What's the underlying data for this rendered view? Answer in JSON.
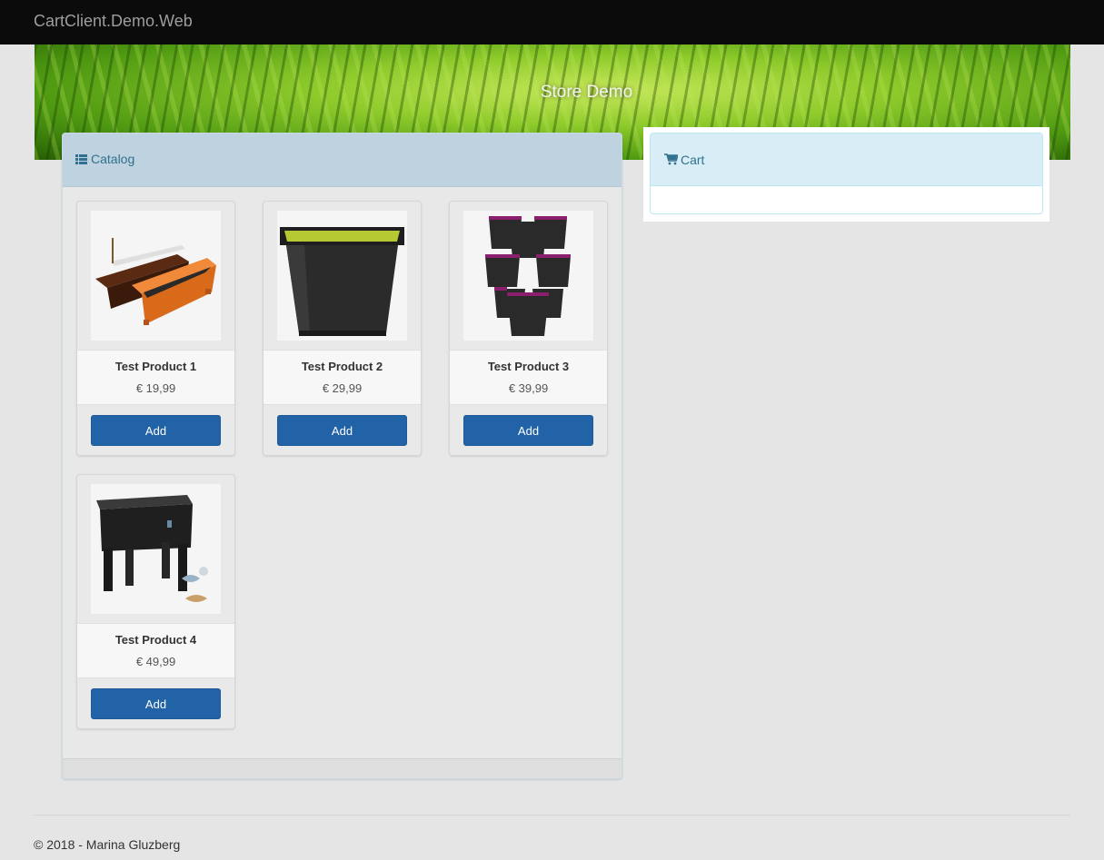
{
  "navbar": {
    "brand": "CartClient.Demo.Web"
  },
  "hero": {
    "title": "Store Demo"
  },
  "catalog": {
    "heading": "Catalog",
    "icon": "list-icon",
    "products": [
      {
        "name": "Test Product 1",
        "price": "€ 19,99",
        "button": "Add",
        "image": "planter-boxes-image"
      },
      {
        "name": "Test Product 2",
        "price": "€ 29,99",
        "button": "Add",
        "image": "square-pot-image"
      },
      {
        "name": "Test Product 3",
        "price": "€ 39,99",
        "button": "Add",
        "image": "stacking-planter-image"
      },
      {
        "name": "Test Product 4",
        "price": "€ 49,99",
        "button": "Add",
        "image": "raised-bed-image"
      }
    ]
  },
  "cart": {
    "heading": "Cart",
    "icon": "shopping-cart-icon"
  },
  "footer": {
    "text": "© 2018 - Marina Gluzberg"
  },
  "colors": {
    "navbar": "#0b0b0b",
    "panel_heading": "#bed3df",
    "info_heading": "#d9edf7",
    "button": "#2163a6",
    "heading_text": "#31708f"
  }
}
